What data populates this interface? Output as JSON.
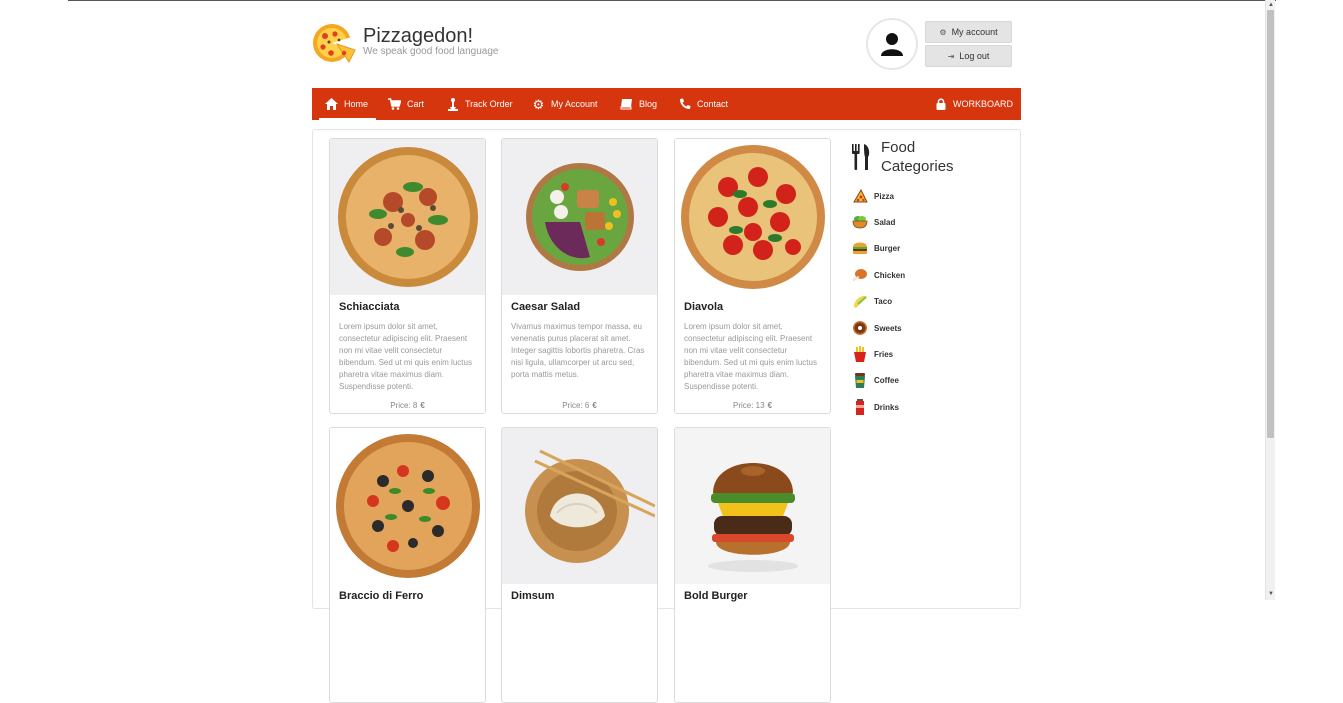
{
  "brand": {
    "name": "Pizzagedon!",
    "tagline": "We speak good food language"
  },
  "account": {
    "my_account": "My account",
    "log_out": "Log out"
  },
  "nav": {
    "items": [
      {
        "label": "Home",
        "icon": "home-icon"
      },
      {
        "label": "Cart",
        "icon": "cart-icon"
      },
      {
        "label": "Track Order",
        "icon": "track-order-icon"
      },
      {
        "label": "My Account",
        "icon": "gear-icon"
      },
      {
        "label": "Blog",
        "icon": "book-icon"
      },
      {
        "label": "Contact",
        "icon": "phone-icon"
      }
    ],
    "workboard": "WORKBOARD",
    "accent_color": "#d6360d"
  },
  "products": [
    {
      "name": "Schiacciata",
      "desc": "Lorem ipsum dolor sit amet, consectetur adipiscing elit. Praesent non mi vitae velit consectetur bibendum. Sed ut mi quis enim luctus pharetra vitae maximus diam. Suspendisse potenti.",
      "price_label": "Price: 8",
      "currency": "€",
      "image": "pizza-schiacciata"
    },
    {
      "name": "Caesar Salad",
      "desc": "Vivamus maximus tempor massa, eu venenatis purus placerat sit amet. Integer sagittis lobortis pharetra. Cras nisi ligula, ullamcorper ut arcu sed, porta mattis metus.",
      "price_label": "Price: 6",
      "currency": "€",
      "image": "salad-bowl"
    },
    {
      "name": "Diavola",
      "desc": "Lorem ipsum dolor sit amet, consectetur adipiscing elit. Praesent non mi vitae velit consectetur bibendum. Sed ut mi quis enim luctus pharetra vitae maximus diam. Suspendisse potenti.",
      "price_label": "Price: 13",
      "currency": "€",
      "image": "pizza-diavola"
    },
    {
      "name": "Braccio di Ferro",
      "desc": "",
      "price_label": "",
      "currency": "",
      "image": "pizza-braccio"
    },
    {
      "name": "Dimsum",
      "desc": "",
      "price_label": "",
      "currency": "",
      "image": "dimsum-bowl"
    },
    {
      "name": "Bold Burger",
      "desc": "",
      "price_label": "",
      "currency": "",
      "image": "burger"
    }
  ],
  "categories": {
    "title_line1": "Food",
    "title_line2": "Categories",
    "items": [
      {
        "label": "Pizza",
        "icon": "pizza-icon"
      },
      {
        "label": "Salad",
        "icon": "salad-icon"
      },
      {
        "label": "Burger",
        "icon": "burger-icon"
      },
      {
        "label": "Chicken",
        "icon": "chicken-icon"
      },
      {
        "label": "Taco",
        "icon": "taco-icon"
      },
      {
        "label": "Sweets",
        "icon": "donut-icon"
      },
      {
        "label": "Fries",
        "icon": "fries-icon"
      },
      {
        "label": "Coffee",
        "icon": "coffee-icon"
      },
      {
        "label": "Drinks",
        "icon": "drink-icon"
      }
    ]
  }
}
